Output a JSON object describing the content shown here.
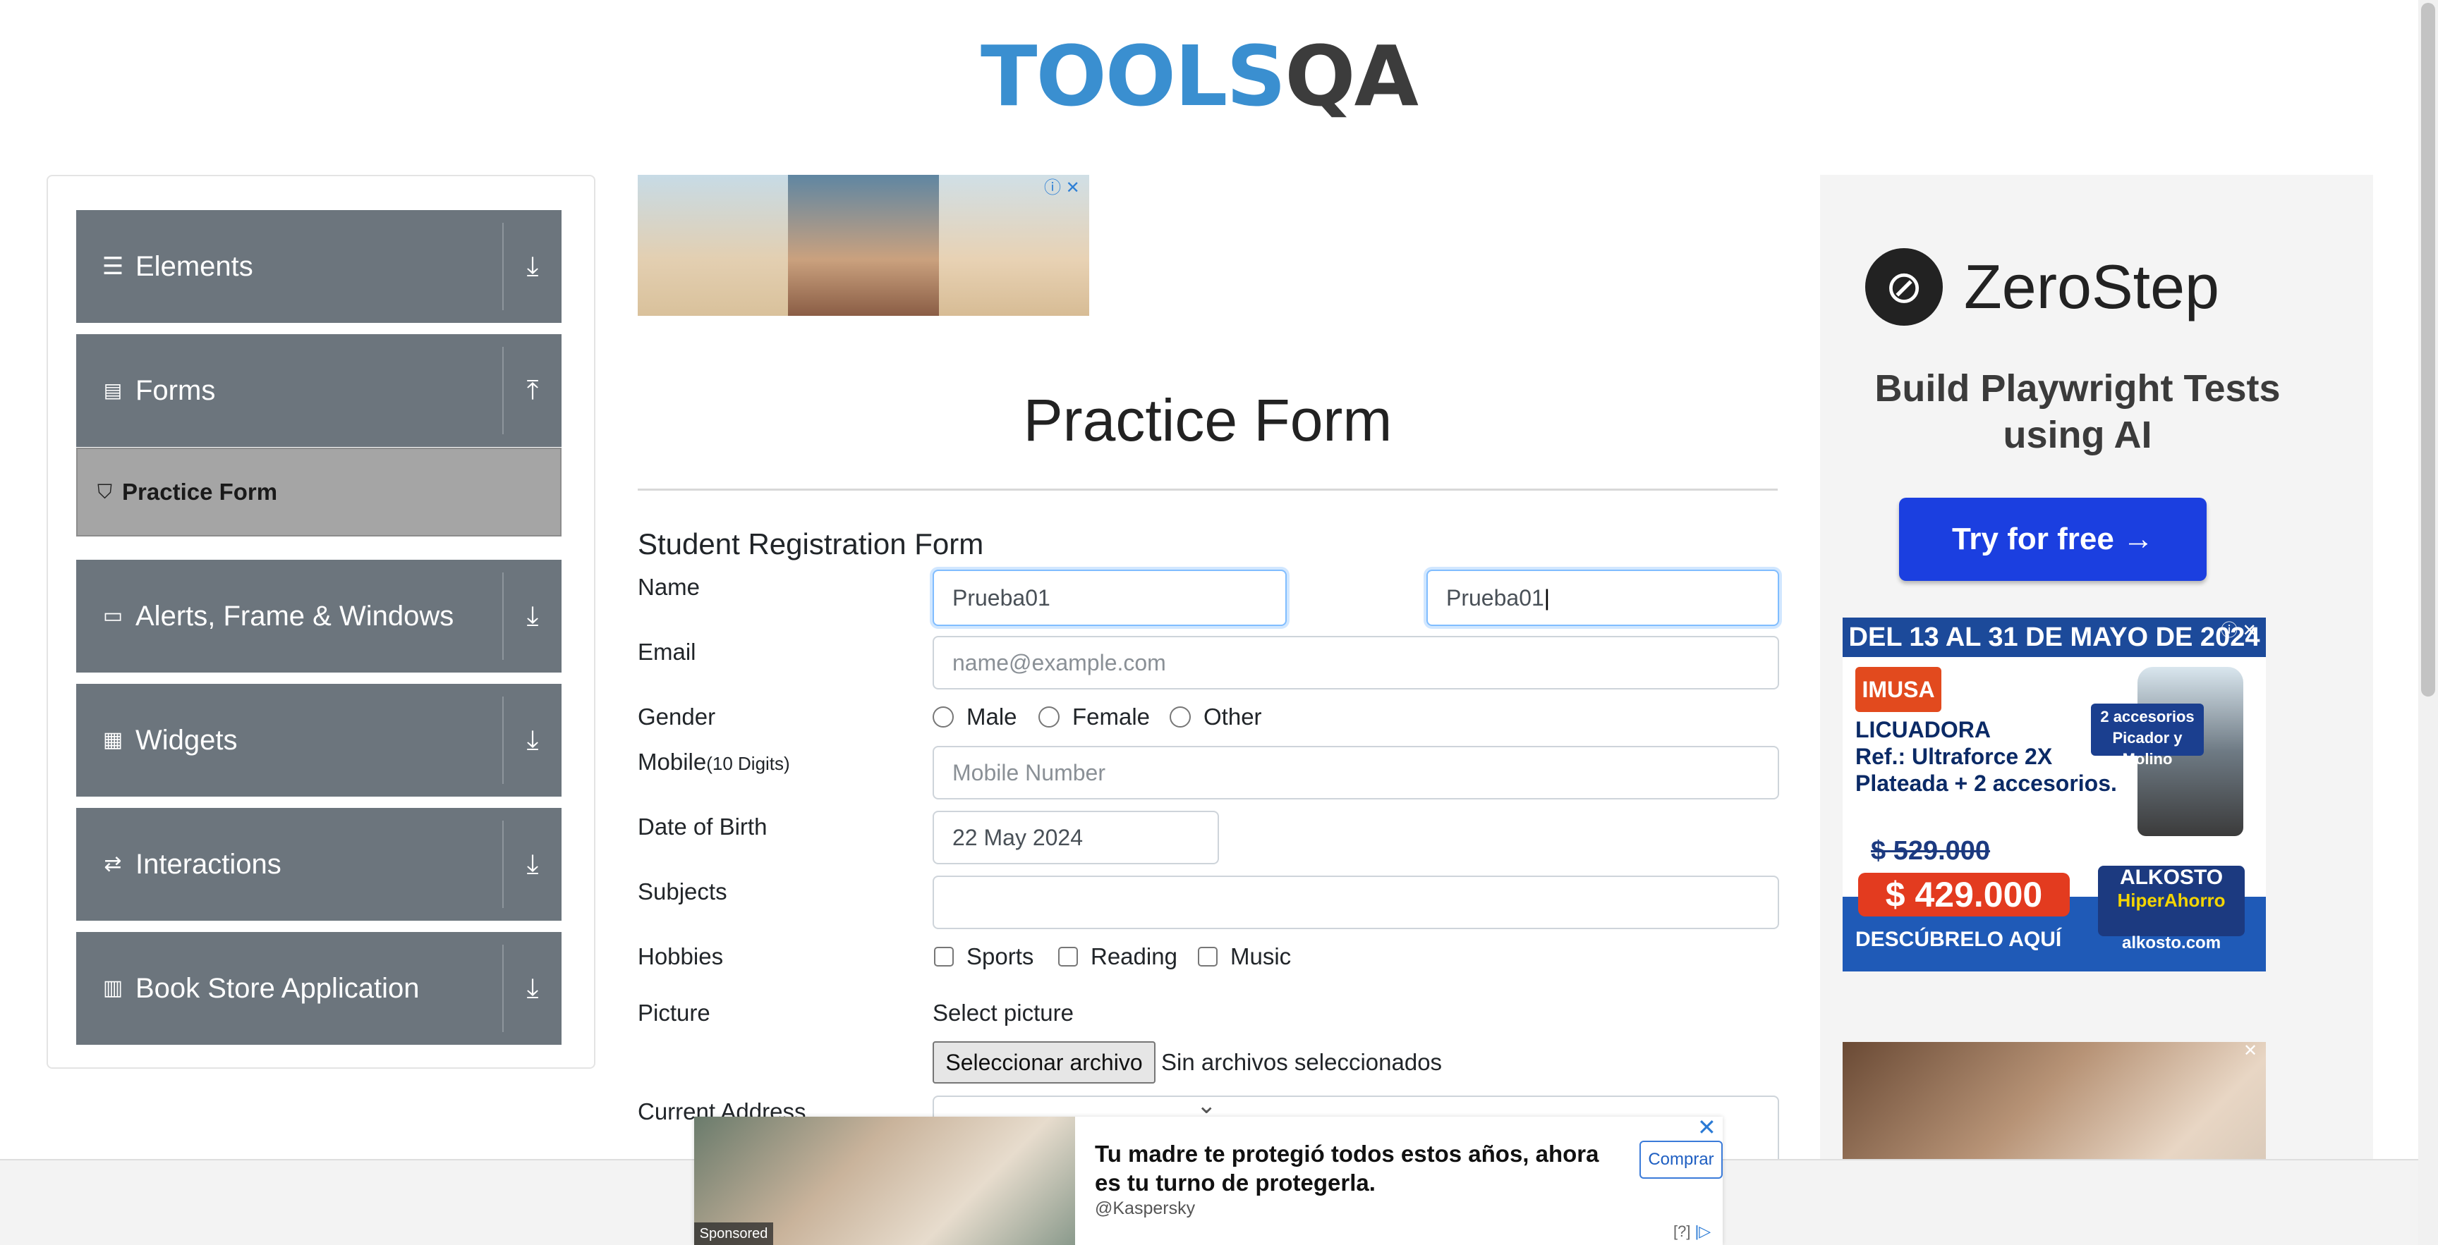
{
  "logo": {
    "part1": "TOOLS",
    "part2": "QA"
  },
  "sidebar": {
    "groups": [
      {
        "label": "Elements",
        "icon": "hamburger-icon",
        "arrow": "⤓"
      },
      {
        "label": "Forms",
        "icon": "document-icon",
        "arrow": "⤒"
      },
      {
        "label": "Alerts, Frame & Windows",
        "icon": "window-icon",
        "arrow": "⤓"
      },
      {
        "label": "Widgets",
        "icon": "widgets-icon",
        "arrow": "⤓"
      },
      {
        "label": "Interactions",
        "icon": "interactions-icon",
        "arrow": "⤓"
      },
      {
        "label": "Book Store Application",
        "icon": "books-icon",
        "arrow": "⤓"
      }
    ],
    "active_item": {
      "label": "Practice Form",
      "icon": "html5-icon"
    }
  },
  "form": {
    "title": "Practice Form",
    "subtitle": "Student Registration Form",
    "labels": {
      "name": "Name",
      "email": "Email",
      "gender": "Gender",
      "mobile": "Mobile",
      "mobile_hint": "(10 Digits)",
      "dob": "Date of Birth",
      "subjects": "Subjects",
      "hobbies": "Hobbies",
      "picture": "Picture",
      "address": "Current Address"
    },
    "first_name": "Prueba01",
    "last_name": "Prueba01",
    "email_placeholder": "name@example.com",
    "gender_options": [
      "Male",
      "Female",
      "Other"
    ],
    "mobile_placeholder": "Mobile Number",
    "dob_value": "22 May 2024",
    "subjects_value": "",
    "hobby_options": [
      "Sports",
      "Reading",
      "Music"
    ],
    "picture_prompt": "Select picture",
    "file_button": "Seleccionar archivo",
    "file_status": "Sin archivos seleccionados"
  },
  "ads": {
    "zerostep": {
      "brand": "ZeroStep",
      "tagline": "Build Playwright Tests using AI",
      "cta": "Try for free →"
    },
    "alkosto": {
      "band": "DEL 13 AL 31 DE MAYO DE 2024",
      "brand": "IMUSA",
      "product_line1": "LICUADORA",
      "product_line2": "Ref.: Ultraforce 2X",
      "product_line3": "Plateada + 2 accesorios.",
      "accessories": "2 accesorios Picador y Molino",
      "old_price": "$ 529.000",
      "new_price": "$ 429.000",
      "cta": "DESCÚBRELO AQUÍ",
      "store": "ALKOSTO",
      "store_sub": "HiperAhorro",
      "url": "alkosto.com"
    },
    "bottom": {
      "headline": "Tu madre te protegió todos estos años, ahora es tu turno de protegerla.",
      "brand": "@Kaspersky",
      "button": "Comprar",
      "sponsored": "Sponsored",
      "info": "[?]"
    }
  }
}
